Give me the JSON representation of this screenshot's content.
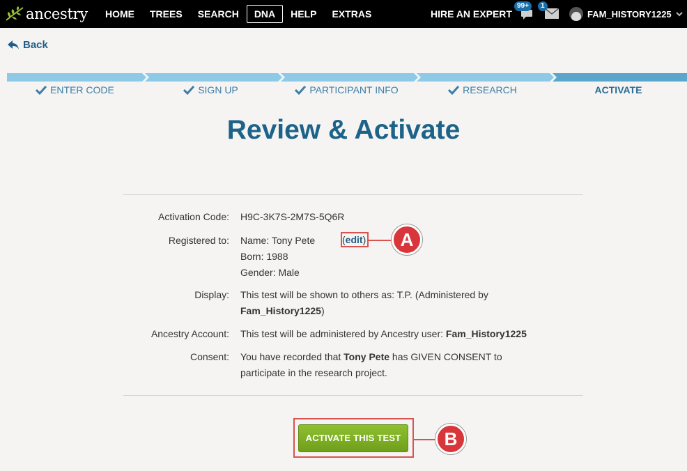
{
  "nav": {
    "logo_text": "ancestry",
    "items": [
      "HOME",
      "TREES",
      "SEARCH",
      "DNA",
      "HELP",
      "EXTRAS"
    ],
    "active_item": "DNA",
    "hire_expert": "HIRE AN EXPERT",
    "notifications_badge": "99+",
    "messages_badge": "1",
    "username": "FAM_HISTORY1225"
  },
  "back_label": "Back",
  "steps": [
    {
      "label": "ENTER CODE",
      "done": true
    },
    {
      "label": "SIGN UP",
      "done": true
    },
    {
      "label": "PARTICIPANT INFO",
      "done": true
    },
    {
      "label": "RESEARCH",
      "done": true
    },
    {
      "label": "ACTIVATE",
      "done": false
    }
  ],
  "title": "Review & Activate",
  "details": {
    "activation_label": "Activation Code:",
    "activation_value": "H9C-3K7S-2M7S-5Q6R",
    "registered_label": "Registered to:",
    "name_line": "Name: Tony Pete",
    "born_line": "Born: 1988",
    "gender_line": "Gender: Male",
    "edit_open": "(",
    "edit_label": "edit",
    "edit_close": ")",
    "display_label": "Display:",
    "display_text": "This test will be shown to others as: T.P. (Administered by",
    "display_user": "Fam_History1225",
    "display_close": ")",
    "account_label": "Ancestry Account:",
    "account_text": "This test will be administered by Ancestry user: ",
    "account_user": "Fam_History1225",
    "consent_label": "Consent:",
    "consent_pre": "You have recorded that ",
    "consent_name": "Tony Pete",
    "consent_post": " has GIVEN CONSENT to",
    "consent_line2": "participate in the research project."
  },
  "activate_button": "ACTIVATE THIS TEST",
  "callouts": {
    "a": "A",
    "b": "B"
  },
  "colors": {
    "progress_done": "#8ecae6",
    "progress_current": "#5ba7cc",
    "title": "#1d6389",
    "button": "#7fb027",
    "callout": "#d8363a"
  }
}
